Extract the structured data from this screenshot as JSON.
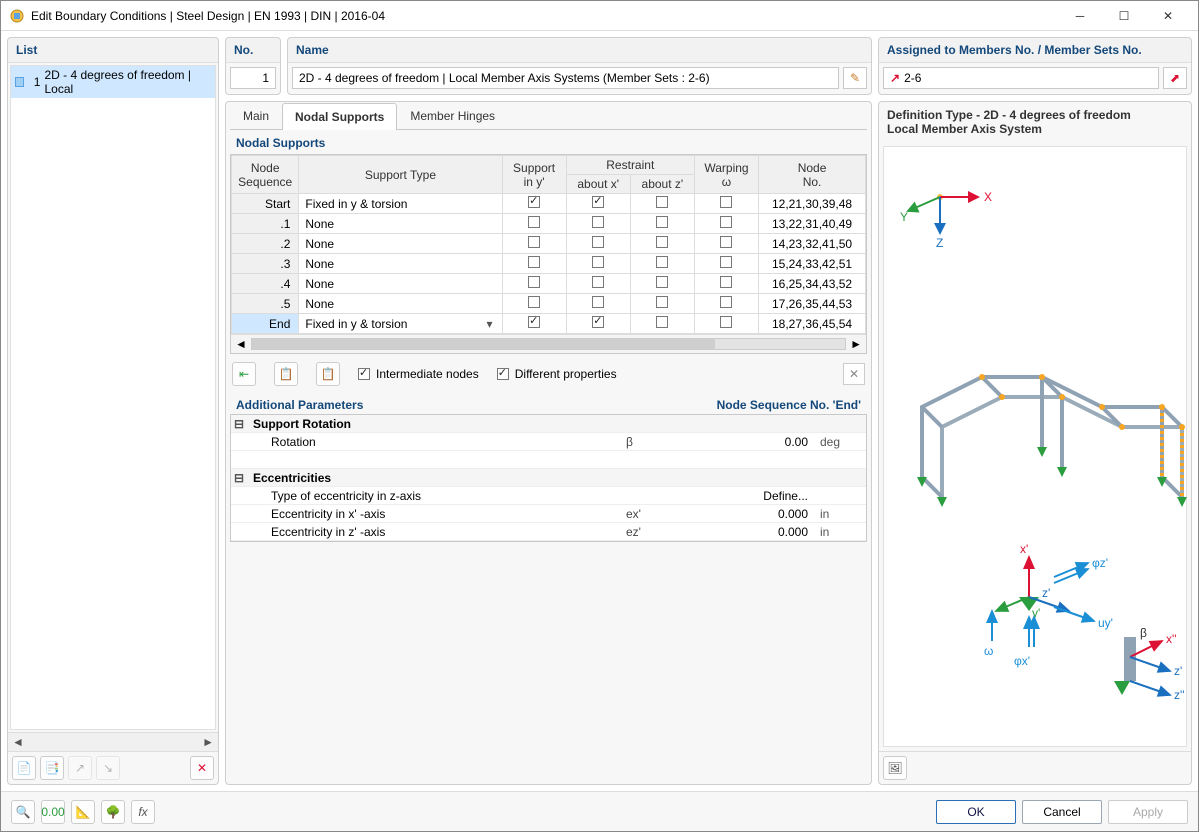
{
  "title": "Edit Boundary Conditions | Steel Design | EN 1993 | DIN | 2016-04",
  "left": {
    "header": "List",
    "item_no": "1",
    "item_label": "2D - 4 degrees of freedom | Local"
  },
  "top": {
    "no_label": "No.",
    "no_value": "1",
    "name_label": "Name",
    "name_value": "2D - 4 degrees of freedom | Local Member Axis Systems (Member Sets : 2-6)",
    "assigned_label": "Assigned to Members No. / Member Sets No.",
    "assigned_value": "2-6"
  },
  "tabs": {
    "main": "Main",
    "nodal": "Nodal Supports",
    "hinges": "Member Hinges"
  },
  "ns": {
    "title": "Nodal Supports",
    "cols": {
      "seq": "Node\nSequence",
      "type": "Support Type",
      "sup": "Support\nin y'",
      "restraint": "Restraint",
      "rx": "about x'",
      "rz": "about z'",
      "warp": "Warping\nω",
      "node": "Node\nNo."
    },
    "rows": [
      {
        "seq": "Start",
        "type": "Fixed in y & torsion",
        "sy": true,
        "rx": true,
        "rz": false,
        "w": false,
        "node": "12,21,30,39,48"
      },
      {
        "seq": ".1",
        "type": "None",
        "sy": false,
        "rx": false,
        "rz": false,
        "w": false,
        "node": "13,22,31,40,49"
      },
      {
        "seq": ".2",
        "type": "None",
        "sy": false,
        "rx": false,
        "rz": false,
        "w": false,
        "node": "14,23,32,41,50"
      },
      {
        "seq": ".3",
        "type": "None",
        "sy": false,
        "rx": false,
        "rz": false,
        "w": false,
        "node": "15,24,33,42,51"
      },
      {
        "seq": ".4",
        "type": "None",
        "sy": false,
        "rx": false,
        "rz": false,
        "w": false,
        "node": "16,25,34,43,52"
      },
      {
        "seq": ".5",
        "type": "None",
        "sy": false,
        "rx": false,
        "rz": false,
        "w": false,
        "node": "17,26,35,44,53"
      },
      {
        "seq": "End",
        "type": "Fixed in y & torsion",
        "sy": true,
        "rx": true,
        "rz": false,
        "w": false,
        "node": "18,27,36,45,54",
        "sel": true,
        "dd": true
      }
    ]
  },
  "opts": {
    "intermediate": "Intermediate nodes",
    "diff": "Different properties"
  },
  "params": {
    "title": "Additional Parameters",
    "context": "Node Sequence No. 'End'",
    "g1": "Support Rotation",
    "r1": {
      "label": "Rotation",
      "sym": "β",
      "val": "0.00",
      "unit": "deg"
    },
    "g2": "Eccentricities",
    "r2": {
      "label": "Type of eccentricity in z-axis",
      "val": "Define..."
    },
    "r3": {
      "label": "Eccentricity in x' -axis",
      "sym": "ex'",
      "val": "0.000",
      "unit": "in"
    },
    "r4": {
      "label": "Eccentricity in z' -axis",
      "sym": "ez'",
      "val": "0.000",
      "unit": "in"
    }
  },
  "viewer": {
    "line1": "Definition Type - 2D - 4 degrees of freedom",
    "line2": "Local Member Axis System"
  },
  "axes": {
    "x": "X",
    "y": "Y",
    "z": "Z"
  },
  "local_labels": {
    "x": "x'",
    "y": "y'",
    "z": "z'",
    "phix": "φx'",
    "phiz": "φz'",
    "uy": "uy'",
    "omega": "ω",
    "beta": "β",
    "x2": "x''",
    "z2": "z'",
    "z3": "z''"
  },
  "footer": {
    "ok": "OK",
    "cancel": "Cancel",
    "apply": "Apply"
  }
}
